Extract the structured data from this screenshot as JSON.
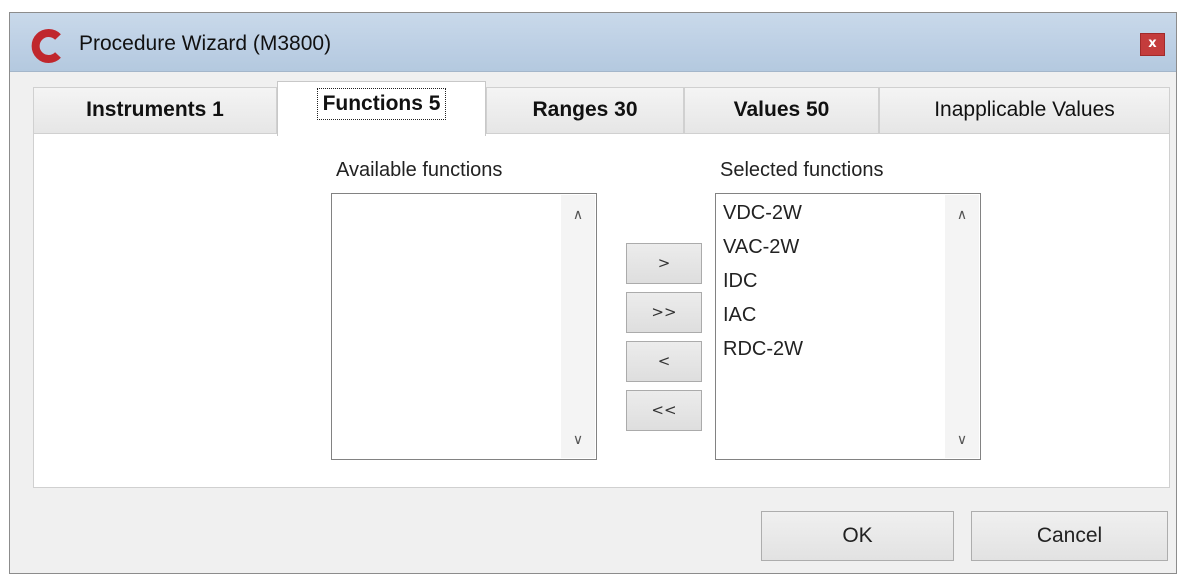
{
  "window": {
    "title": "Procedure Wizard (M3800)",
    "close_glyph": "x",
    "accent_color": "#c0272d"
  },
  "tabs": [
    {
      "label": "Instruments 1",
      "active": false
    },
    {
      "label": "Functions 5",
      "active": true
    },
    {
      "label": "Ranges 30",
      "active": false
    },
    {
      "label": "Values 50",
      "active": false
    },
    {
      "label": "Inapplicable Values",
      "active": false
    }
  ],
  "available": {
    "label": "Available functions",
    "items": []
  },
  "selected": {
    "label": "Selected functions",
    "items": [
      "VDC-2W",
      "VAC-2W",
      "IDC",
      "IAC",
      "RDC-2W"
    ]
  },
  "move_buttons": {
    "add": ">",
    "add_all": ">>",
    "remove": "<",
    "remove_all": "<<"
  },
  "footer": {
    "ok": "OK",
    "cancel": "Cancel"
  },
  "icons": {
    "app": "c-logo-icon",
    "scroll_up": "scroll-up-icon",
    "scroll_down": "scroll-down-icon"
  }
}
